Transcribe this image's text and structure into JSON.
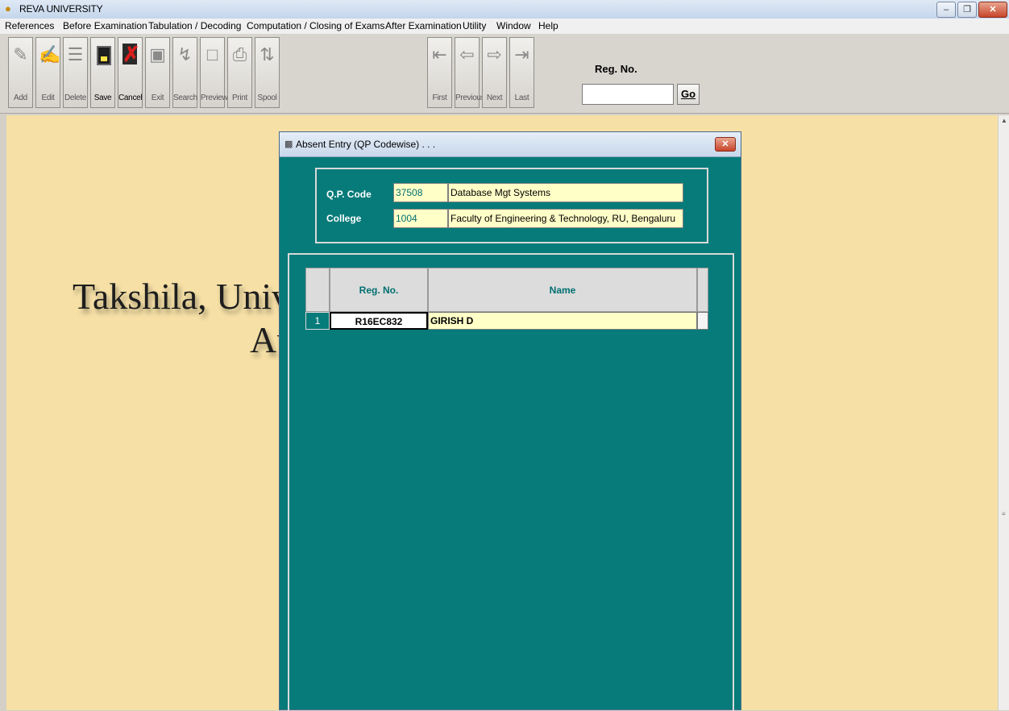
{
  "window": {
    "title": "REVA UNIVERSITY",
    "controls": [
      "–",
      "❐",
      "✕"
    ]
  },
  "menubar": {
    "items": [
      "References",
      "Before Examination",
      "Tabulation / Decoding",
      "Computation / Closing of Exams",
      "After Examination",
      "Utility",
      "Window",
      "Help"
    ]
  },
  "toolbar": {
    "buttons": [
      "Add",
      "Edit",
      "Delete",
      "Save",
      "Cancel",
      "Exit",
      "Search",
      "Preview",
      "Print",
      "Spool"
    ],
    "nav_buttons": [
      "First",
      "Previous",
      "Next",
      "Last"
    ],
    "regno_label": "Reg. No.",
    "regno_value": "",
    "go_label": "Go"
  },
  "background": {
    "watermark_line1": "Takshila, Univ",
    "watermark_line2": "Au"
  },
  "dialog": {
    "title": "Absent Entry (QP Codewise) . . .",
    "close": "✕",
    "qp_code_label": "Q.P. Code",
    "qp_code": "37508",
    "qp_name": "Database Mgt Systems",
    "college_label": "College",
    "college_code": "1004",
    "college_name": "Faculty of Engineering & Technology, RU, Bengaluru",
    "grid": {
      "columns": [
        "Reg. No.",
        "Name"
      ],
      "rows": [
        {
          "num": "1",
          "reg_no": "R16EC832",
          "name": "GIRISH D"
        }
      ]
    }
  }
}
